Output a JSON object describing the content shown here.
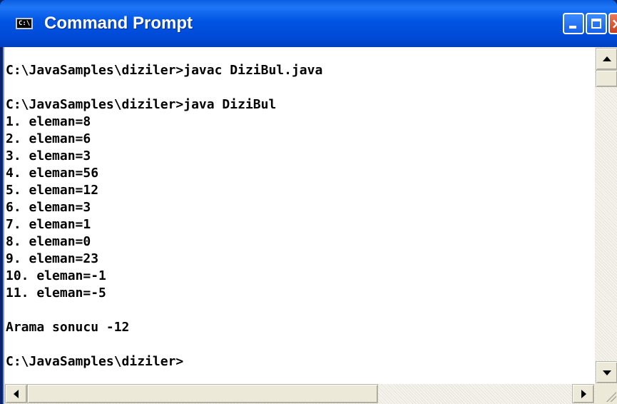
{
  "window": {
    "title": "Command Prompt",
    "icon_label": "C:\\",
    "buttons": {
      "minimize": "minimize",
      "maximize": "maximize",
      "close": "×"
    }
  },
  "console": {
    "lines": [
      "C:\\JavaSamples\\diziler>javac DiziBul.java",
      "",
      "C:\\JavaSamples\\diziler>java DiziBul",
      "1. eleman=8",
      "2. eleman=6",
      "3. eleman=3",
      "4. eleman=56",
      "5. eleman=12",
      "6. eleman=3",
      "7. eleman=1",
      "8. eleman=0",
      "9. eleman=23",
      "10. eleman=-1",
      "11. eleman=-5",
      "",
      "Arama sonucu -12",
      "",
      "C:\\JavaSamples\\diziler>"
    ]
  },
  "colors": {
    "titlebar": "#0054e3",
    "console_bg": "#ffffff",
    "console_text": "#000000"
  },
  "icons": [
    "cmd-icon",
    "minimize-icon",
    "maximize-icon",
    "close-icon",
    "scroll-up-icon",
    "scroll-down-icon",
    "scroll-left-icon",
    "scroll-right-icon"
  ]
}
